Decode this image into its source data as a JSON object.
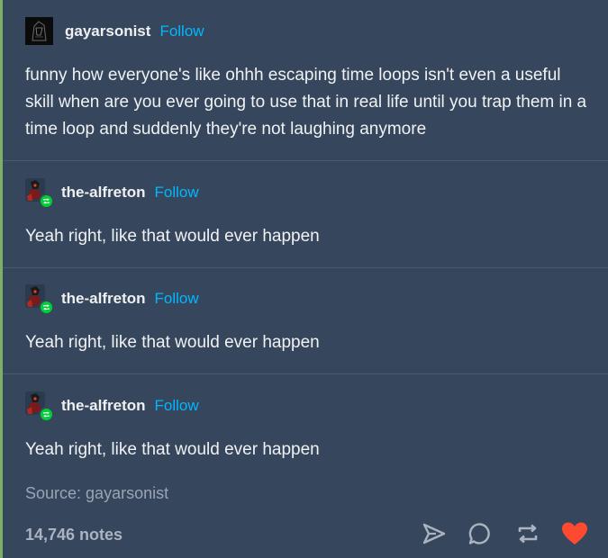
{
  "original_post": {
    "username": "gayarsonist",
    "follow_label": "Follow",
    "text": "funny how everyone's like ohhh escaping time loops isn't even a useful skill when are you ever going to use that in real life until you trap them in a time loop and suddenly they're not laughing anymore"
  },
  "reblogs": [
    {
      "username": "the-alfreton",
      "follow_label": "Follow",
      "text": "Yeah right, like that would ever happen"
    },
    {
      "username": "the-alfreton",
      "follow_label": "Follow",
      "text": "Yeah right, like that would ever happen"
    },
    {
      "username": "the-alfreton",
      "follow_label": "Follow",
      "text": "Yeah right, like that would ever happen"
    }
  ],
  "footer": {
    "source_prefix": "Source: ",
    "source_user": "gayarsonist",
    "notes": "14,746 notes"
  },
  "icons": {
    "share": "send-icon",
    "reply": "reply-bubble-icon",
    "reblog": "reblog-icon",
    "like": "heart-icon"
  },
  "colors": {
    "background": "#36465d",
    "follow": "#00b8ff",
    "reblog_badge": "#00cf35",
    "heart": "#ff4930",
    "rail": "#7bb067"
  }
}
